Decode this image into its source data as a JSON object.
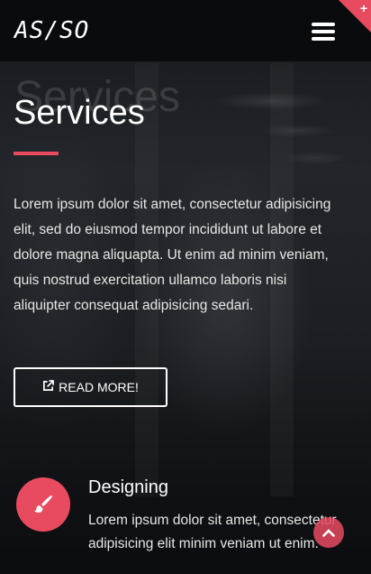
{
  "header": {
    "logo": "AS/SO",
    "menu_icon": "hamburger-icon",
    "corner_icon": "plus-icon",
    "corner_symbol": "+"
  },
  "hero": {
    "ghost_title": "Services",
    "title": "Services",
    "description": "Lorem ipsum dolor sit amet, consectetur adipisicing elit, sed do eiusmod tempor incididunt ut labore et dolore magna aliquapta. Ut enim ad minim veniam, quis nostrud exercitation ullamco laboris nisi aliquipter consequat adipisicing sedari.",
    "button_label": "READ MORE!",
    "button_icon": "external-link-icon"
  },
  "feature": {
    "icon": "paintbrush-icon",
    "title": "Designing",
    "text": "Lorem ipsum dolor sit amet, consectetur adipisicing elit minim veniam ut enim."
  },
  "scroll_top_icon": "chevron-up-icon",
  "colors": {
    "accent": "#e84a5f",
    "background": "#0e1013",
    "text": "#ffffff"
  }
}
